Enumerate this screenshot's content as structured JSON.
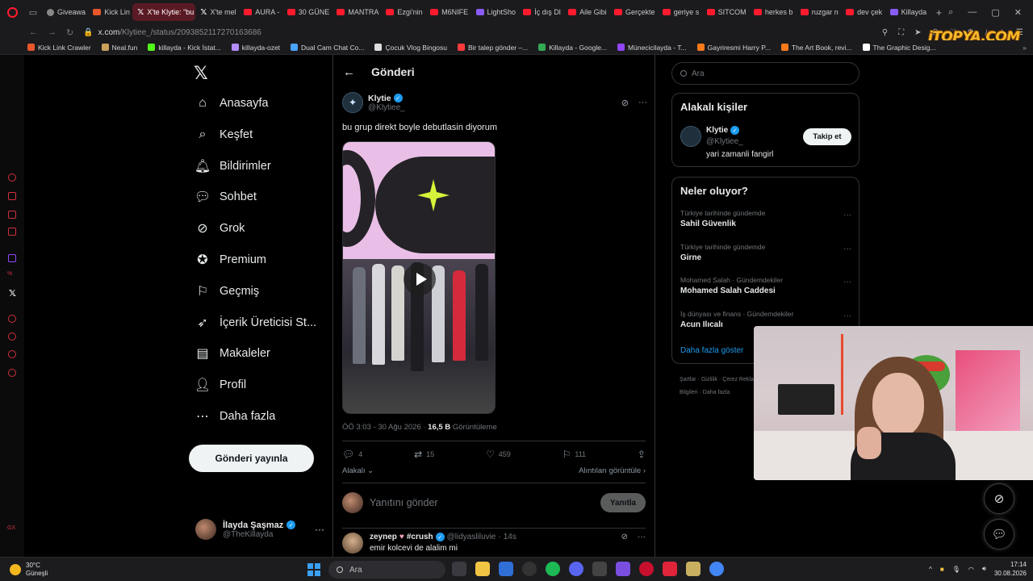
{
  "browser": {
    "tabs": [
      {
        "label": "Giveawa",
        "fav": "g",
        "active": false
      },
      {
        "label": "Kick Lin",
        "fav": "k",
        "active": false
      },
      {
        "label": "X'te Klytie: \"bu",
        "fav": "x",
        "active": true
      },
      {
        "label": "X'te mel",
        "fav": "x",
        "active": false
      },
      {
        "label": "AURA - ",
        "fav": "r",
        "active": false
      },
      {
        "label": "30 GÜNE",
        "fav": "r",
        "active": false
      },
      {
        "label": "MANTRA",
        "fav": "r",
        "active": false
      },
      {
        "label": "Ezgi'nin",
        "fav": "r",
        "active": false
      },
      {
        "label": "M6NIFE",
        "fav": "r",
        "active": false
      },
      {
        "label": "LightSho",
        "fav": "p",
        "active": false
      },
      {
        "label": "İç dış Dl",
        "fav": "r",
        "active": false
      },
      {
        "label": "Aile Gibi",
        "fav": "r",
        "active": false
      },
      {
        "label": "Gerçekte",
        "fav": "r",
        "active": false
      },
      {
        "label": "geriye s",
        "fav": "r",
        "active": false
      },
      {
        "label": "SITCOM",
        "fav": "r",
        "active": false
      },
      {
        "label": "herkes b",
        "fav": "r",
        "active": false
      },
      {
        "label": "ruzgar n",
        "fav": "r",
        "active": false
      },
      {
        "label": "dev çek",
        "fav": "r",
        "active": false
      },
      {
        "label": "Killayda",
        "fav": "p",
        "active": false
      }
    ],
    "url_host": "x.com",
    "url_path": "/Klytiee_/status/2093852117270163686",
    "watermark": "iTOPYA.COM",
    "bookmarks": [
      {
        "label": "Kick Link Crawler",
        "color": "#e7572a"
      },
      {
        "label": "Neal.fun",
        "color": "#c9a15a"
      },
      {
        "label": "killayda - Kick İstat...",
        "color": "#53fc18"
      },
      {
        "label": "killayda-ozet",
        "color": "#b48bff"
      },
      {
        "label": "Dual Cam Chat Co...",
        "color": "#4aa3ff"
      },
      {
        "label": "Çocuk Vlog Bingosu",
        "color": "#dddddd"
      },
      {
        "label": "Bir talep gönder –...",
        "color": "#ff3b3b"
      },
      {
        "label": "Killayda - Google...",
        "color": "#34a853"
      },
      {
        "label": "Münecicilayda - T...",
        "color": "#9146ff"
      },
      {
        "label": "Gayriresmi Harry P...",
        "color": "#ff7a1a"
      },
      {
        "label": "The Art Book, revi...",
        "color": "#ff7a1a"
      },
      {
        "label": "The Graphic Desig...",
        "color": "#ffffff"
      }
    ]
  },
  "nav": {
    "items": [
      {
        "label": "Anasayfa",
        "icon": "home-icon"
      },
      {
        "label": "Keşfet",
        "icon": "search-icon"
      },
      {
        "label": "Bildirimler",
        "icon": "bell-icon"
      },
      {
        "label": "Sohbet",
        "icon": "chat-icon"
      },
      {
        "label": "Grok",
        "icon": "grok-icon"
      },
      {
        "label": "Premium",
        "icon": "premium-icon"
      },
      {
        "label": "Geçmiş",
        "icon": "bookmark-icon"
      },
      {
        "label": "İçerik Üreticisi St...",
        "icon": "rocket-icon"
      },
      {
        "label": "Makaleler",
        "icon": "article-icon"
      },
      {
        "label": "Profil",
        "icon": "profile-icon"
      },
      {
        "label": "Daha fazla",
        "icon": "more-icon"
      }
    ],
    "post_button": "Gönderi yayınla",
    "account": {
      "name": "İlayda Şaşmaz",
      "handle": "@TheKillayda"
    }
  },
  "main": {
    "title": "Gönderi",
    "tweet": {
      "name": "Klytie",
      "handle": "@Klytiee_",
      "text": "bu grup direkt boyle debutlasin diyorum",
      "time": "ÖÖ 3:03 - 30 Ağu 2026",
      "views": "16,5 B",
      "views_label": "Görüntüleme",
      "replies": "4",
      "retweets": "15",
      "likes": "459",
      "bookmarks": "111"
    },
    "sort_label": "Alakalı",
    "quotes_label": "Alıntıları görüntüle",
    "reply_placeholder": "Yanıtını gönder",
    "reply_button": "Yanıtla",
    "reply": {
      "name": "zeynep",
      "tag": "#crush",
      "handle": "@lidyasliluvie",
      "age": "14s",
      "text": "emir kolcevi de alalim mi"
    }
  },
  "right": {
    "search_placeholder": "Ara",
    "related_title": "Alakalı kişiler",
    "related": {
      "name": "Klytie",
      "handle": "@Klytiee_",
      "bio": "yari zamanli fangirl",
      "follow": "Takip et"
    },
    "trends_title": "Neler oluyor?",
    "trends": [
      {
        "context": "Türkiye tarihinde gündemde",
        "title": "Sahil Güvenlik"
      },
      {
        "context": "Türkiye tarihinde gündemde",
        "title": "Girne"
      },
      {
        "context": "Mohamed Salah · Gündemdekiler",
        "title": "Mohamed Salah Caddesi"
      },
      {
        "context": "İş dünyası ve finans · Gündemdekiler",
        "title": "Acun Ilıcalı"
      }
    ],
    "show_more": "Daha fazla göster",
    "footer": "Şartlar · Gizlilik · Çerez Reklam Bilgileri · Daha fazla"
  },
  "taskbar": {
    "temp": "30°C",
    "weather": "Güneşli",
    "search": "Ara",
    "time": "17:14",
    "date": "30.08.2026"
  },
  "colors": {
    "accent": "#1d9bf0",
    "opera_red": "#ff1b2d"
  }
}
